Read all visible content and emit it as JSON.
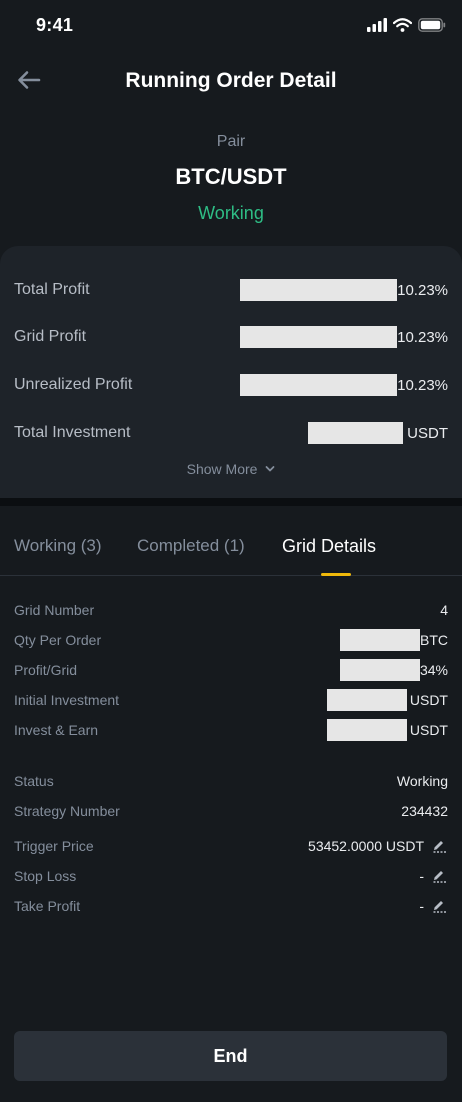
{
  "status_bar": {
    "time": "9:41"
  },
  "header": {
    "title": "Running Order Detail"
  },
  "pair": {
    "label": "Pair",
    "value": "BTC/USDT",
    "status": "Working"
  },
  "summary": {
    "rows": [
      {
        "label": "Total Profit",
        "value": "10.23%"
      },
      {
        "label": "Grid Profit",
        "value": "10.23%"
      },
      {
        "label": "Unrealized Profit",
        "value": "10.23%"
      },
      {
        "label": "Total Investment",
        "value": "USDT"
      }
    ],
    "show_more": "Show More"
  },
  "tabs": [
    {
      "label": "Working (3)"
    },
    {
      "label": "Completed (1)"
    },
    {
      "label": "Grid Details"
    }
  ],
  "grid_details": [
    {
      "label": "Grid Number",
      "value": "4"
    },
    {
      "label": "Qty Per Order",
      "value": "BTC"
    },
    {
      "label": "Profit/Grid",
      "value": "34%"
    },
    {
      "label": "Initial Investment",
      "value": "USDT"
    },
    {
      "label": "Invest & Earn",
      "value": "USDT"
    }
  ],
  "strategy_details": [
    {
      "label": "Status",
      "value": "Working"
    },
    {
      "label": "Strategy Number",
      "value": "234432"
    },
    {
      "label": "Trigger Price",
      "value": "53452.0000 USDT"
    },
    {
      "label": "Stop Loss",
      "value": "-"
    },
    {
      "label": "Take Profit",
      "value": "-"
    }
  ],
  "end_button": {
    "label": "End"
  },
  "colors": {
    "positive": "#2ebd85",
    "accent": "#f0b90b",
    "background": "#161a1e",
    "card": "#1e2329"
  },
  "icons": [
    "back-arrow-icon",
    "cellular-signal-icon",
    "wifi-icon",
    "battery-icon",
    "chevron-down-icon",
    "edit-pencil-icon"
  ]
}
